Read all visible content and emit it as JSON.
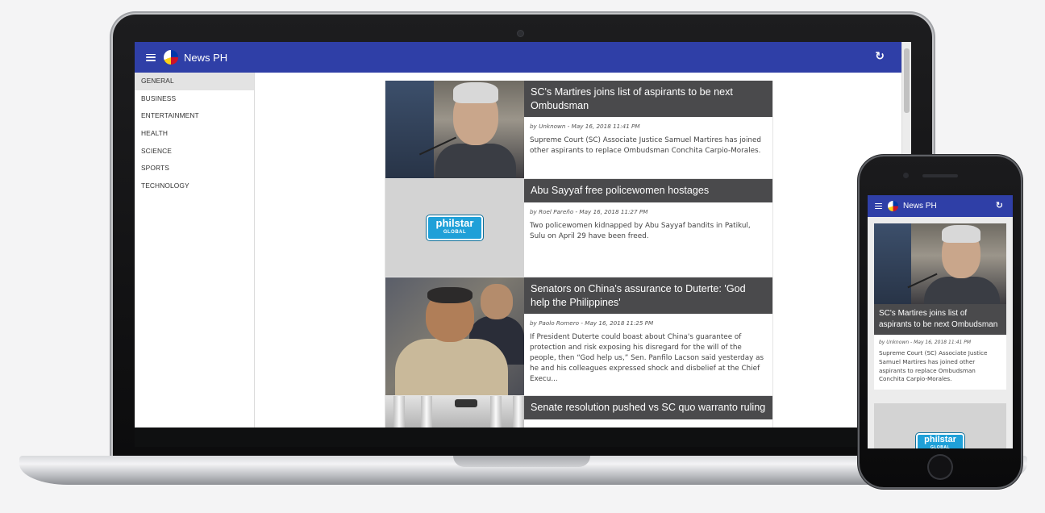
{
  "app": {
    "title": "News PH",
    "menu_icon": "menu-icon",
    "logo_icon": "philippine-flag-logo-icon",
    "refresh_icon": "refresh-icon",
    "refresh_glyph": "↻",
    "accent_color": "#2f3fa7"
  },
  "sidebar": {
    "items": [
      {
        "label": "GENERAL",
        "active": true
      },
      {
        "label": "BUSINESS"
      },
      {
        "label": "ENTERTAINMENT"
      },
      {
        "label": "HEALTH"
      },
      {
        "label": "SCIENCE"
      },
      {
        "label": "SPORTS"
      },
      {
        "label": "TECHNOLOGY"
      }
    ]
  },
  "articles": [
    {
      "title": "SC's Martires joins list of aspirants to be next Ombudsman",
      "meta": "by Unknown - May 16, 2018 11:41 PM",
      "summary": "Supreme Court (SC) Associate Justice Samuel Martires has joined other aspirants to replace Ombudsman Conchita Carpio-Morales."
    },
    {
      "title": "Abu Sayyaf free policewomen hostages",
      "meta": "by Roel Pareño - May 16, 2018 11:27 PM",
      "summary": "Two policewomen kidnapped by Abu Sayyaf bandits in Patikul, Sulu on April 29 have been freed.",
      "logo": {
        "word": "philstar",
        "sub": "GLOBAL"
      }
    },
    {
      "title": "Senators on China's assurance to Duterte: 'God help the Philippines'",
      "meta": "by Paolo Romero - May 16, 2018 11:25 PM",
      "summary": "If President Duterte could boast about China's guarantee of protection and risk exposing his disregard for the will of the people, then “God help us,” Sen. Panfilo Lacson said yesterday as he and his colleagues expressed shock and disbelief at the Chief Execu..."
    },
    {
      "title": "Senate resolution pushed vs SC quo warranto ruling"
    }
  ]
}
